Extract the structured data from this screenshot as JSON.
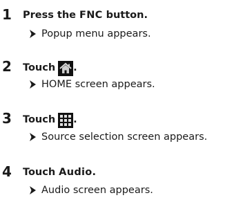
{
  "steps": [
    {
      "number": "1",
      "parts": {
        "pre": "Press the",
        "keyword": "FNC",
        "post": "button."
      },
      "result": "Popup menu appears."
    },
    {
      "number": "2",
      "parts": {
        "pre": "Touch",
        "icon": "home-icon",
        "post": "."
      },
      "result": "HOME screen appears."
    },
    {
      "number": "3",
      "parts": {
        "pre": "Touch",
        "icon": "grid-icon",
        "post": "."
      },
      "result": "Source selection screen appears."
    },
    {
      "number": "4",
      "parts": {
        "pre": "Touch",
        "keyword": "Audio",
        "post": "."
      },
      "result": "Audio screen appears."
    }
  ]
}
